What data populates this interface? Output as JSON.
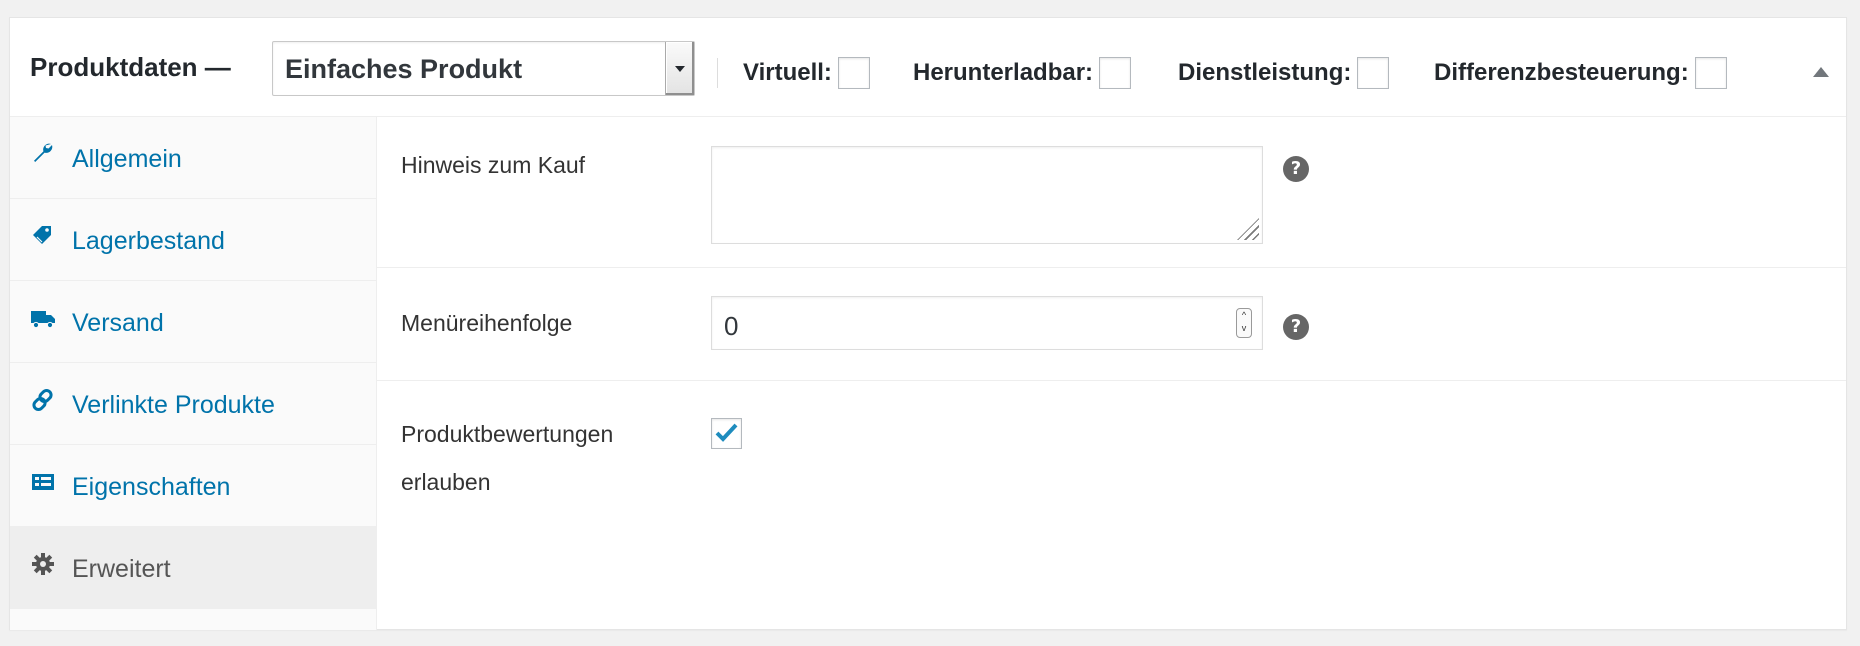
{
  "header": {
    "title": "Produktdaten —",
    "product_type": {
      "selected": "Einfaches Produkt"
    },
    "options": [
      {
        "label": "Virtuell:",
        "checked": false
      },
      {
        "label": "Herunterladbar:",
        "checked": false
      },
      {
        "label": "Dienstleistung:",
        "checked": false
      },
      {
        "label": "Differenzbesteuerung:",
        "checked": false
      }
    ],
    "collapse_icon": "triangle-up-icon"
  },
  "sidebar": {
    "items": [
      {
        "label": "Allgemein",
        "icon": "wrench-icon",
        "active": false
      },
      {
        "label": "Lagerbestand",
        "icon": "tag-icon",
        "active": false
      },
      {
        "label": "Versand",
        "icon": "truck-icon",
        "active": false
      },
      {
        "label": "Verlinkte Produkte",
        "icon": "link-icon",
        "active": false
      },
      {
        "label": "Eigenschaften",
        "icon": "list-icon",
        "active": false
      },
      {
        "label": "Erweitert",
        "icon": "gear-icon",
        "active": true
      }
    ]
  },
  "main": {
    "purchase_note": {
      "label": "Hinweis zum Kauf",
      "value": "",
      "help": "?"
    },
    "menu_order": {
      "label": "Menüreihenfolge",
      "value": "0",
      "help": "?"
    },
    "reviews": {
      "label_line1": "Produktbewertungen",
      "label_line2": "erlauben",
      "checked": true
    }
  },
  "colors": {
    "link": "#0073aa",
    "active_tab_bg": "#eeeeee",
    "check": "#1e8cbe"
  }
}
